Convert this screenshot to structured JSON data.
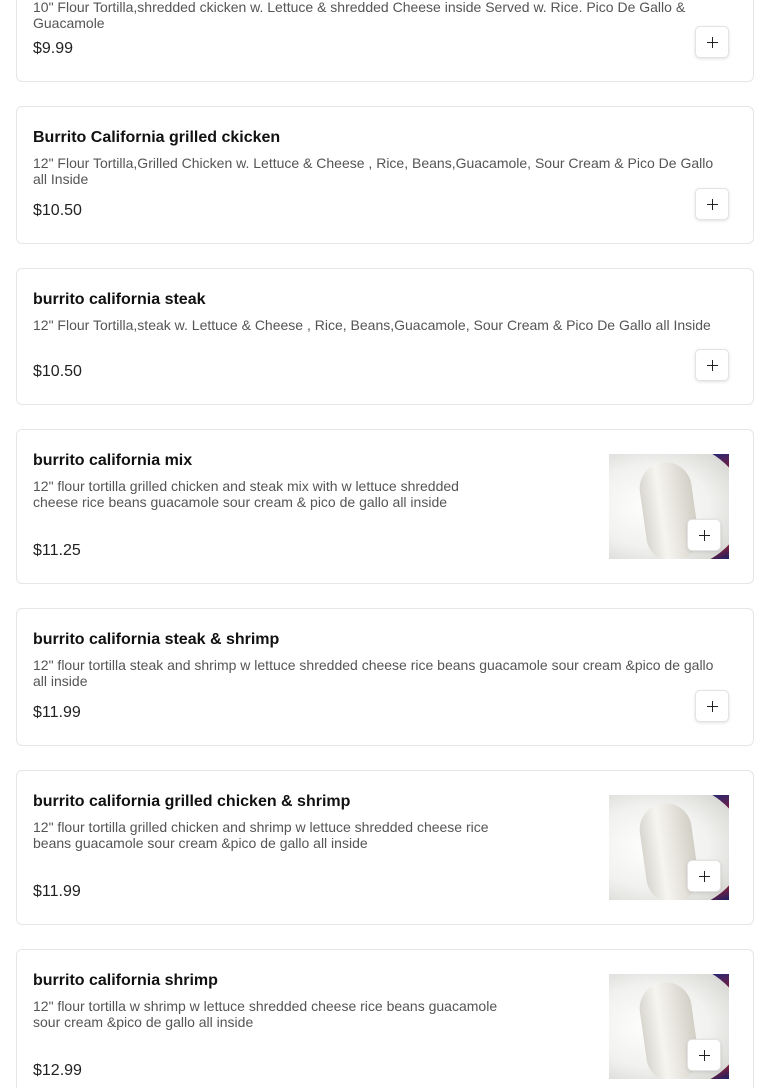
{
  "menu": {
    "items": [
      {
        "name": "",
        "description": "10\" Flour Tortilla,shredded ckicken w. Lettuce & shredded Cheese inside Served w. Rice. Pico De Gallo & Guacamole",
        "price": "$9.99",
        "has_image": false
      },
      {
        "name": "Burrito California grilled ckicken",
        "description": "12\" Flour Tortilla,Grilled Chicken w. Lettuce & Cheese , Rice, Beans,Guacamole, Sour Cream & Pico De Gallo all Inside",
        "price": "$10.50",
        "has_image": false
      },
      {
        "name": "burrito california steak",
        "description": "12\" Flour Tortilla,steak w. Lettuce & Cheese , Rice, Beans,Guacamole, Sour Cream & Pico De Gallo all Inside",
        "price": "$10.50",
        "has_image": false
      },
      {
        "name": "burrito california mix",
        "description": "12\" flour tortilla grilled chicken and steak mix with w lettuce shredded cheese rice beans guacamole sour cream & pico de gallo all inside",
        "price": "$11.25",
        "has_image": true
      },
      {
        "name": "burrito california steak & shrimp",
        "description": "12\" flour tortilla steak and shrimp w lettuce shredded cheese rice beans guacamole sour cream &pico de gallo all inside",
        "price": "$11.99",
        "has_image": false
      },
      {
        "name": "burrito california grilled chicken & shrimp",
        "description": "12\" flour tortilla grilled chicken and shrimp w lettuce shredded cheese rice beans guacamole sour cream &pico de gallo all inside",
        "price": "$11.99",
        "has_image": true
      },
      {
        "name": "burrito california shrimp",
        "description": "12\" flour tortilla w shrimp w lettuce shredded cheese rice beans guacamole sour cream &pico de gallo all inside",
        "price": "$12.99",
        "has_image": true
      }
    ],
    "add_icon": "plus-icon"
  },
  "colors": {
    "border": "#e6e6e6",
    "title": "#111111",
    "description": "#555555",
    "price": "#222222"
  }
}
